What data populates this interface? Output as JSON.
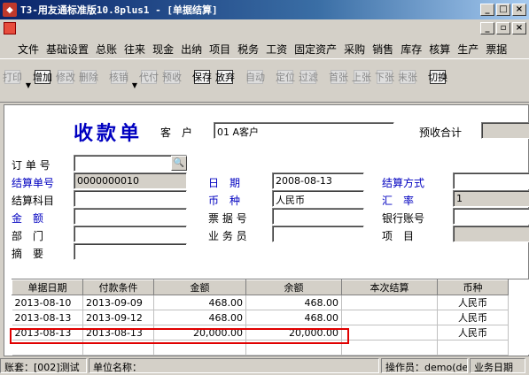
{
  "window": {
    "title": "T3-用友通标准版10.8plus1 - [单据结算]",
    "buttons": {
      "minimize": "_",
      "maximize": "□",
      "close": "×"
    }
  },
  "menu": {
    "items": [
      "文件",
      "基础设置",
      "总账",
      "往来",
      "现金",
      "出纳",
      "项目",
      "税务",
      "工资",
      "固定资产",
      "采购",
      "销售",
      "库存",
      "核算",
      "生产",
      "票据"
    ],
    "mdi_buttons": {
      "minimize": "_",
      "restore": "▫",
      "close": "×"
    }
  },
  "toolbar": {
    "buttons": [
      {
        "id": "print",
        "label": "打印",
        "enabled": false
      },
      {
        "id": "add",
        "label": "增加",
        "enabled": true
      },
      {
        "id": "modify",
        "label": "修改",
        "enabled": false
      },
      {
        "id": "delete",
        "label": "删除",
        "enabled": false
      },
      {
        "id": "writeoff",
        "label": "核销",
        "enabled": false
      },
      {
        "id": "agent",
        "label": "代付",
        "enabled": false
      },
      {
        "id": "prepay",
        "label": "预收",
        "enabled": false
      },
      {
        "id": "save",
        "label": "保存",
        "enabled": true
      },
      {
        "id": "discard",
        "label": "放弃",
        "enabled": true
      },
      {
        "id": "auto",
        "label": "自动",
        "enabled": false
      },
      {
        "id": "locate",
        "label": "定位",
        "enabled": false
      },
      {
        "id": "filter",
        "label": "过滤",
        "enabled": false
      },
      {
        "id": "first",
        "label": "首张",
        "enabled": false
      },
      {
        "id": "prev",
        "label": "上张",
        "enabled": false
      },
      {
        "id": "next",
        "label": "下张",
        "enabled": false
      },
      {
        "id": "last",
        "label": "末张",
        "enabled": false
      },
      {
        "id": "switch",
        "label": "切换",
        "enabled": true
      }
    ]
  },
  "form": {
    "title": "收款单",
    "customer_label": "客　户",
    "customer_value": "01  A客户",
    "prepay_total_label": "预收合计",
    "fields": {
      "order_no": {
        "label": "订 单 号",
        "value": ""
      },
      "settle_no": {
        "label": "结算单号",
        "value": "0000000010"
      },
      "settle_subject": {
        "label": "结算科目",
        "value": ""
      },
      "amount": {
        "label": "金　额",
        "value": ""
      },
      "dept": {
        "label": "部　门",
        "value": ""
      },
      "summary": {
        "label": "摘　要",
        "value": ""
      },
      "date": {
        "label": "日　期",
        "value": "2008-08-13"
      },
      "currency": {
        "label": "币　种",
        "value": "人民币"
      },
      "bill_no": {
        "label": "票 据 号",
        "value": ""
      },
      "salesman": {
        "label": "业 务 员",
        "value": ""
      },
      "settle_method": {
        "label": "结算方式",
        "value": ""
      },
      "rate": {
        "label": "汇　率",
        "value": "1"
      },
      "bank_account": {
        "label": "银行账号",
        "value": ""
      },
      "project": {
        "label": "项　目",
        "value": ""
      }
    }
  },
  "grid": {
    "columns": [
      "单据日期",
      "付款条件",
      "金额",
      "余额",
      "本次结算",
      "币种"
    ],
    "rows": [
      {
        "doc_date": "2013-08-10",
        "terms": "2013-09-09",
        "amount": "468.00",
        "balance": "468.00",
        "settle": "",
        "currency": "人民币"
      },
      {
        "doc_date": "2013-08-13",
        "terms": "2013-09-12",
        "amount": "468.00",
        "balance": "468.00",
        "settle": "",
        "currency": "人民币"
      },
      {
        "doc_date": "2013-08-13",
        "terms": "2013-08-13",
        "amount": "20,000.00",
        "balance": "20,000.00",
        "settle": "",
        "currency": "人民币"
      }
    ]
  },
  "statusbar": {
    "account": "账套：[002]测试",
    "unit": "单位名称：",
    "operator": "操作员：demo(de",
    "biz_date": "业务日期"
  }
}
